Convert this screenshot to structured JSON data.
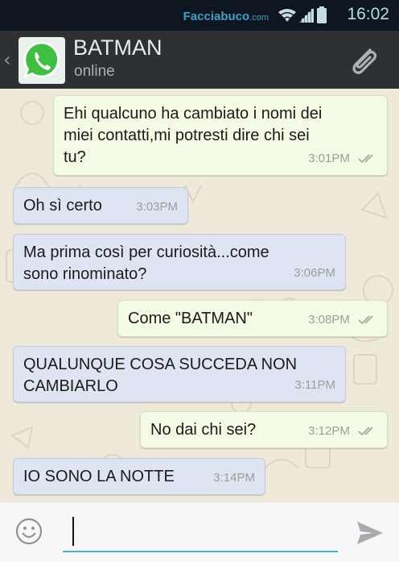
{
  "status_bar": {
    "brand": "Facciabuco",
    "brand_tld": ".com",
    "time": "16:02"
  },
  "header": {
    "contact_name": "BATMAN",
    "contact_status": "online"
  },
  "messages": [
    {
      "direction": "out",
      "text": "Ehi qualcuno ha cambiato i nomi dei\nmiei contatti,mi potresti dire chi sei\ntu?",
      "time": "3:01PM"
    },
    {
      "direction": "in",
      "text": "Oh sì certo",
      "time": "3:03PM"
    },
    {
      "direction": "in",
      "text": "Ma prima così per curiosità...come\nsono rinominato?",
      "time": "3:06PM"
    },
    {
      "direction": "out",
      "text": "Come \"BATMAN\"",
      "time": "3:08PM"
    },
    {
      "direction": "in",
      "text": "QUALUNQUE COSA SUCCEDA NON\nCAMBIARLO",
      "time": "3:11PM"
    },
    {
      "direction": "out",
      "text": "No dai chi sei?",
      "time": "3:12PM"
    },
    {
      "direction": "in",
      "text": "IO SONO LA NOTTE",
      "time": "3:14PM"
    }
  ],
  "input": {
    "value": ""
  },
  "colors": {
    "header_bg": "#2d3134",
    "status_bar_bg": "#0e1620",
    "outgoing_bubble": "#f4fbe4",
    "incoming_bubble": "#dee4f2",
    "accent": "#3bb5d8",
    "whatsapp_green": "#3fbf3f"
  },
  "icons": {
    "wifi": "wifi-icon",
    "signal": "signal-icon",
    "battery": "battery-icon",
    "back": "chevron-left-icon",
    "avatar": "whatsapp-logo-icon",
    "attach": "paperclip-icon",
    "emoji": "smiley-icon",
    "send": "send-icon",
    "read": "double-check-icon"
  }
}
